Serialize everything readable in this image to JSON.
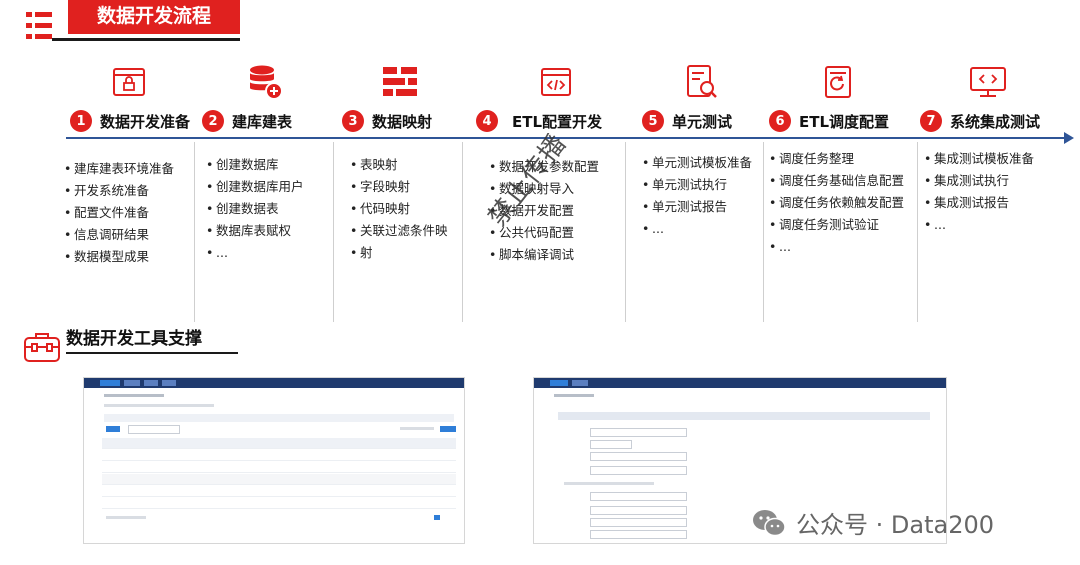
{
  "header": {
    "title": "数据开发流程"
  },
  "steps": [
    {
      "num": "1",
      "label": "数据开发准备",
      "icon": "browser-lock-icon",
      "items": [
        "建库建表环境准备",
        "开发系统准备",
        "配置文件准备",
        "信息调研结果",
        "数据模型成果"
      ]
    },
    {
      "num": "2",
      "label": "建库建表",
      "icon": "database-add-icon",
      "items": [
        "创建数据库",
        "创建数据库用户",
        "创建数据表",
        "数据库表赋权",
        "..."
      ]
    },
    {
      "num": "3",
      "label": "数据映射",
      "icon": "mapping-grid-icon",
      "items": [
        "表映射",
        "字段映射",
        "代码映射",
        "关联过滤条件映",
        "射"
      ]
    },
    {
      "num": "4",
      "label": "ETL配置开发",
      "icon": "code-window-icon",
      "items": [
        "数据开发参数配置",
        "数据映射导入",
        "数据开发配置",
        "公共代码配置",
        "脚本编译调试"
      ]
    },
    {
      "num": "5",
      "label": "单元测试",
      "icon": "doc-search-icon",
      "items": [
        "单元测试模板准备",
        "单元测试执行",
        "单元测试报告",
        "..."
      ]
    },
    {
      "num": "6",
      "label": "ETL调度配置",
      "icon": "doc-refresh-icon",
      "items": [
        "调度任务整理",
        " 调度任务基础信息配置",
        " 调度任务依赖触发配置",
        "调度任务测试验证",
        "..."
      ]
    },
    {
      "num": "7",
      "label": "系统集成测试",
      "icon": "monitor-code-icon",
      "items": [
        "集成测试模板准备",
        "集成测试执行",
        "集成测试报告",
        "..."
      ]
    }
  ],
  "watermark": "禁止传播",
  "tools": {
    "title": "数据开发工具支撑"
  },
  "footer": {
    "wechat_text": "公众号 · Data200"
  },
  "colors": {
    "accent": "#e0211f",
    "timeline": "#2f5597"
  }
}
